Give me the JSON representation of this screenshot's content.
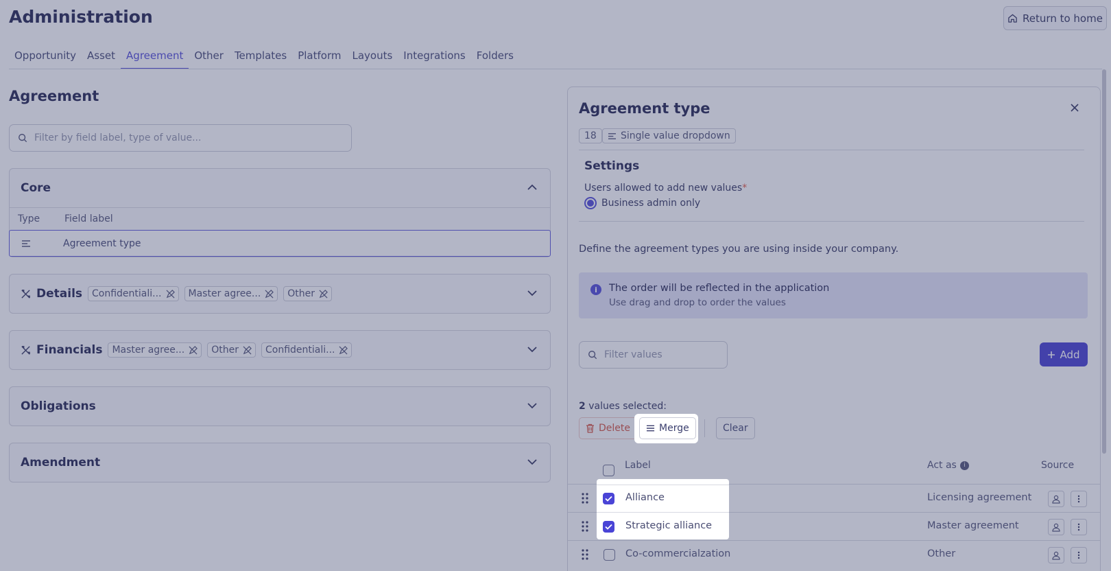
{
  "header": {
    "title": "Administration",
    "return_home": "Return to home"
  },
  "tabs": [
    {
      "label": "Opportunity"
    },
    {
      "label": "Asset"
    },
    {
      "label": "Agreement"
    },
    {
      "label": "Other"
    },
    {
      "label": "Templates"
    },
    {
      "label": "Platform"
    },
    {
      "label": "Layouts"
    },
    {
      "label": "Integrations"
    },
    {
      "label": "Folders"
    }
  ],
  "active_tab": "Agreement",
  "left": {
    "title": "Agreement",
    "filter_placeholder": "Filter by field label, type of value...",
    "core": {
      "title": "Core",
      "col_type": "Type",
      "col_label": "Field label",
      "row_label": "Agreement type"
    },
    "details": {
      "title": "Details",
      "pills": [
        "Confidentiali...",
        "Master agree...",
        "Other"
      ]
    },
    "financials": {
      "title": "Financials",
      "pills": [
        "Master agree...",
        "Other",
        "Confidentiali..."
      ]
    },
    "obligations": {
      "title": "Obligations"
    },
    "amendment": {
      "title": "Amendment"
    }
  },
  "panel": {
    "title": "Agreement type",
    "id_badge": "18",
    "type_badge": "Single value dropdown",
    "settings_title": "Settings",
    "allowed_label": "Users allowed to add new values",
    "required_mark": "*",
    "radio_option": "Business admin only",
    "define_text": "Define the agreement types you are using inside your company.",
    "info_title": "The order will be reflected in the application",
    "info_sub": "Use drag and drop to order the values",
    "info_icon": "i",
    "filter_placeholder": "Filter values",
    "add_label": "Add",
    "selected_count": "2",
    "selected_text": "values selected:",
    "delete_label": "Delete",
    "merge_label": "Merge",
    "clear_label": "Clear",
    "col_label": "Label",
    "col_act_as": "Act as",
    "col_source": "Source",
    "rows": [
      {
        "label": "Alliance",
        "act_as": "Licensing agreement",
        "checked": true
      },
      {
        "label": "Strategic alliance",
        "act_as": "Master agreement",
        "checked": true
      },
      {
        "label": "Co-commercialzation",
        "act_as": "Other",
        "checked": false
      }
    ]
  },
  "colors": {
    "accent": "#4a44d6",
    "danger": "#d24c3a",
    "overlay": "rgba(75,80,120,0.42)"
  }
}
